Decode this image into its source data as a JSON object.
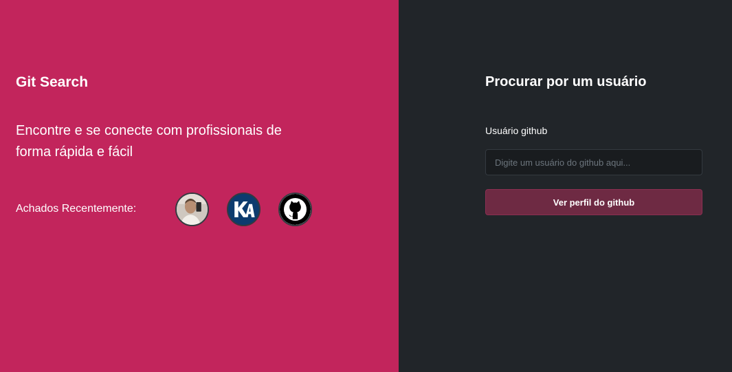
{
  "header": {
    "title": "Git Search",
    "tagline": "Encontre e se conecte com profissionais de forma rápida e fácil"
  },
  "recent": {
    "label": "Achados Recentemente:",
    "avatars": [
      {
        "icon": "user-photo-avatar-icon"
      },
      {
        "icon": "ka-logo-avatar-icon"
      },
      {
        "icon": "github-octocat-avatar-icon"
      }
    ]
  },
  "search": {
    "title": "Procurar por um usuário",
    "field_label": "Usuário github",
    "placeholder": "Digite um usuário do github aqui...",
    "value": "",
    "button_label": "Ver perfil do github"
  },
  "colors": {
    "left_panel": "#c2255c",
    "right_panel": "#212529",
    "input_bg": "#191c1f",
    "button_bg": "#6e2a43"
  }
}
